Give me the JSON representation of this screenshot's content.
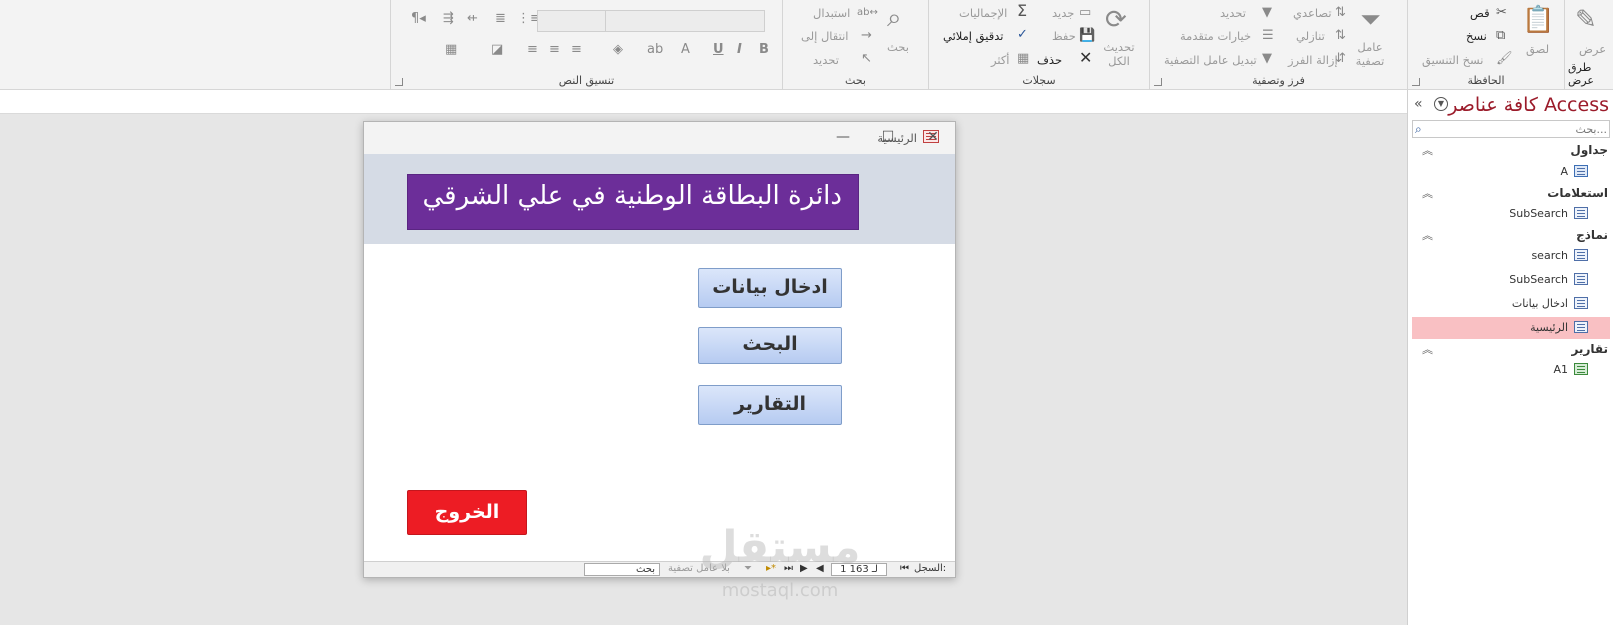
{
  "ribbon": {
    "view": {
      "label": "عرض",
      "group": "طرق عرض"
    },
    "clipboard": {
      "paste": "لصق",
      "cut": "قص",
      "copy": "نسخ",
      "format_painter": "نسخ التنسيق",
      "group": "الحافظة"
    },
    "sort_filter": {
      "filter": "عامل تصفية",
      "ascending": "تصاعدي",
      "descending": "تنازلي",
      "remove_sort": "إزالة الفرز",
      "selection": "تحديد",
      "advanced": "خيارات متقدمة",
      "toggle_filter": "تبديل عامل التصفية",
      "group": "فرز وتصفية"
    },
    "records": {
      "refresh": "تحديث الكل",
      "new": "جديد",
      "save": "حفظ",
      "delete": "حذف",
      "totals": "الإجماليات",
      "spelling": "تدقيق إملائي",
      "more": "أكثر",
      "group": "سجلات"
    },
    "find": {
      "find": "بحث",
      "replace": "استبدال",
      "goto": "انتقال إلى",
      "select": "تحديد",
      "group": "بحث"
    },
    "text_format": {
      "bold": "B",
      "italic": "I",
      "underline": "U",
      "group": "تنسيق النص"
    }
  },
  "nav": {
    "title": "كافة عناصر Access",
    "search_placeholder": "بحث...",
    "categories": {
      "tables": "جداول",
      "queries": "استعلامات",
      "forms": "نماذج",
      "reports": "تقارير"
    },
    "items": {
      "table_a": "A",
      "query_subsearch": "SubSearch",
      "form_search": "search",
      "form_subsearch": "SubSearch",
      "form_data_entry": "ادخال بيانات",
      "form_main": "الرئيسية",
      "report_a1": "A1"
    }
  },
  "form": {
    "window_title": "الرئيسية",
    "header_text": "دائرة البطاقة الوطنية في علي الشرقي",
    "buttons": {
      "data_entry": "ادخال بيانات",
      "search": "البحث",
      "reports": "التقارير",
      "exit": "الخروج"
    },
    "record_nav": {
      "label": "السجل:",
      "position": "1 لـ 163",
      "no_filter": "بلا عامل تصفية",
      "search": "بحث"
    }
  },
  "watermark": {
    "main": "مستقل",
    "sub": "mostaql.com"
  },
  "colors": {
    "header_banner": "#6c2e99",
    "header_band": "#d5dbe5",
    "exit_button": "#ed1c24",
    "nav_title": "#9b1b2a",
    "nav_selected": "#f9c0c3"
  }
}
